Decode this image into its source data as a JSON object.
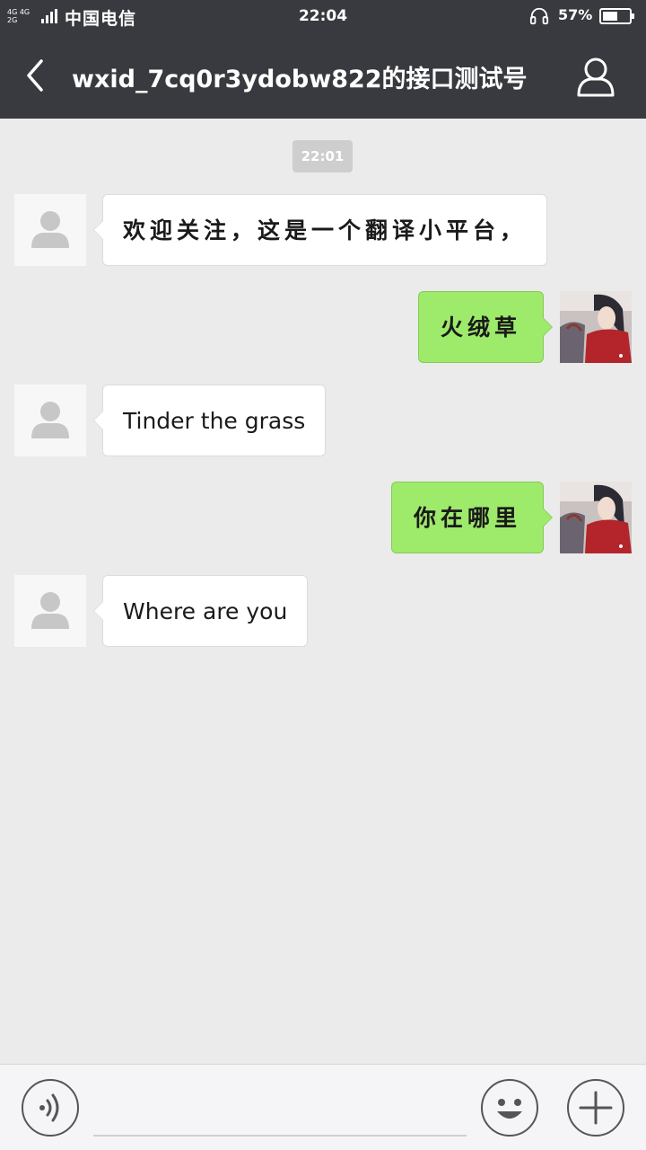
{
  "status_bar": {
    "network_top": "4G 4G",
    "network_bottom": "2G",
    "carrier": "中国电信",
    "time": "22:04",
    "battery_percent": "57%",
    "battery_level": 0.57,
    "icons": [
      "signal-icon",
      "headset-icon",
      "battery-icon"
    ]
  },
  "header": {
    "title": "wxid_7cq0r3ydobw822的接口测试号",
    "back_icon": "chevron-left-icon",
    "profile_icon": "person-icon"
  },
  "chat": {
    "timestamp": "22:01",
    "messages": [
      {
        "direction": "in",
        "text": "欢迎关注，这是一个翻译小平台，",
        "avatar": "default-avatar"
      },
      {
        "direction": "out",
        "text": "火绒草",
        "avatar": "user-avatar"
      },
      {
        "direction": "in",
        "text": "Tinder the grass",
        "avatar": "default-avatar"
      },
      {
        "direction": "out",
        "text": "你在哪里",
        "avatar": "user-avatar"
      },
      {
        "direction": "in",
        "text": "Where are you",
        "avatar": "default-avatar"
      }
    ]
  },
  "input_bar": {
    "voice_icon": "voice-icon",
    "emoji_icon": "smiley-icon",
    "plus_icon": "plus-icon",
    "text_value": ""
  },
  "colors": {
    "header_bg": "#393a3f",
    "chat_bg": "#ebebeb",
    "outgoing_bubble": "#9eea6a",
    "incoming_bubble": "#ffffff"
  }
}
